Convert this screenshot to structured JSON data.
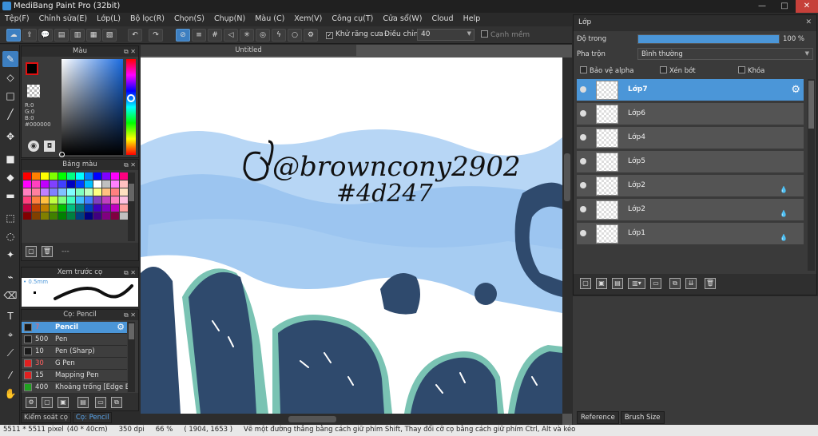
{
  "titlebar": {
    "title": "MediBang Paint Pro (32bit)"
  },
  "window_controls": {
    "minimize": "—",
    "maximize": "□",
    "close": "✕"
  },
  "menu": [
    "Tệp(F)",
    "Chỉnh sửa(E)",
    "Lớp(L)",
    "Bộ lọc(R)",
    "Chọn(S)",
    "Chụp(N)",
    "Màu (C)",
    "Xem(V)",
    "Công cụ(T)",
    "Cửa sổ(W)",
    "Cloud",
    "Help"
  ],
  "toolbar": {
    "antialias_label": "Khử răng cưa",
    "adjust_label": "Điều chỉnh",
    "adjust_value": "40",
    "snap_label": "Cạnh mềm"
  },
  "color_panel": {
    "title": "Màu",
    "rgb": [
      "R:0",
      "G:0",
      "B:0"
    ],
    "hex": "#000000",
    "primary_color": "#000000",
    "secondary_color": "#ffffff"
  },
  "palette_panel": {
    "title": "Bảng màu",
    "swatches": [
      "#ff0000",
      "#ff8000",
      "#ffff00",
      "#80ff00",
      "#00ff00",
      "#00ff80",
      "#00ffff",
      "#0080ff",
      "#0000ff",
      "#8000ff",
      "#ff00ff",
      "#ff0080",
      "#ff00ff",
      "#ff40c0",
      "#c000ff",
      "#8040ff",
      "#4040ff",
      "#0000c0",
      "#0040ff",
      "#00c0ff",
      "#ffffff",
      "#c0c0c0",
      "#ff80ff",
      "#ffc0c0",
      "#ff80c0",
      "#ff80a0",
      "#c080ff",
      "#8080ff",
      "#80c0ff",
      "#80ffff",
      "#80ffc0",
      "#c0ffc0",
      "#ffff80",
      "#ffc080",
      "#ff8080",
      "#ffe0c0",
      "#ff4080",
      "#ff8040",
      "#ffc040",
      "#c0ff40",
      "#80ff80",
      "#40ffc0",
      "#40c0ff",
      "#4080ff",
      "#8040c0",
      "#c040c0",
      "#ff80c0",
      "#ffc0e0",
      "#c00040",
      "#c04000",
      "#c08000",
      "#80c000",
      "#00c000",
      "#00c080",
      "#008080",
      "#0040c0",
      "#4000c0",
      "#8000c0",
      "#c000c0",
      "#ffa0a0",
      "#800000",
      "#804000",
      "#808000",
      "#408000",
      "#008000",
      "#008040",
      "#004080",
      "#000080",
      "#400080",
      "#800080",
      "#800040",
      "#c0c0c0"
    ],
    "page_label": "---"
  },
  "brush_preview": {
    "title": "Xem trước cọ",
    "size_label": "0.5mm"
  },
  "brush_panel": {
    "title": "Cọ: Pencil",
    "brushes": [
      {
        "size": "7",
        "name": "Pencil",
        "color": "#1a1a1a"
      },
      {
        "size": "500",
        "name": "Pen",
        "color": "#1a1a1a"
      },
      {
        "size": "10",
        "name": "Pen (Sharp)",
        "color": "#1a1a1a"
      },
      {
        "size": "30",
        "name": "G Pen",
        "color": "#e02020"
      },
      {
        "size": "15",
        "name": "Mapping Pen",
        "color": "#e02020"
      },
      {
        "size": "400",
        "name": "Khoảng trống [Edge Bl",
        "color": "#20a020"
      }
    ]
  },
  "bottom_tabs": [
    "Kiểm soát cọ",
    "Cọ: Pencil"
  ],
  "document": {
    "tab_title": "Untitled"
  },
  "canvas": {
    "signature_line1": "@browncony2902",
    "signature_line2": "#4d247"
  },
  "layer_panel": {
    "title": "Lớp",
    "opacity_label": "Độ trong",
    "opacity_value": "100 %",
    "opacity_fraction": 1.0,
    "blend_label": "Pha trộn",
    "blend_value": "Bình thường",
    "protect_alpha": "Bảo vệ alpha",
    "clipping": "Xén bớt",
    "lock": "Khóa",
    "layers": [
      {
        "name": "Lớp7",
        "selected": true
      },
      {
        "name": "Lớp6",
        "selected": false
      },
      {
        "name": "Lớp4",
        "selected": false
      },
      {
        "name": "Lớp5",
        "selected": false
      },
      {
        "name": "Lớp2",
        "selected": false
      },
      {
        "name": "Lớp2",
        "selected": false
      },
      {
        "name": "Lớp1",
        "selected": false
      }
    ]
  },
  "right_tabs": [
    "Reference",
    "Brush Size"
  ],
  "status": {
    "dims": "5511 * 5511 pixel",
    "physical": "(40 * 40cm)",
    "dpi": "350 dpi",
    "zoom": "66 %",
    "coords": "( 1904, 1653 )",
    "hint": "Vẽ một đường thẳng bằng cách giữ phím Shift, Thay đổi cỡ cọ bằng cách giữ phím Ctrl, Alt và kéo"
  },
  "colors": {
    "accent": "#4b96d8",
    "sky": "#a9cdf2",
    "letter_fill": "#2f4a6d",
    "letter_shadow": "#7ac3b3"
  }
}
